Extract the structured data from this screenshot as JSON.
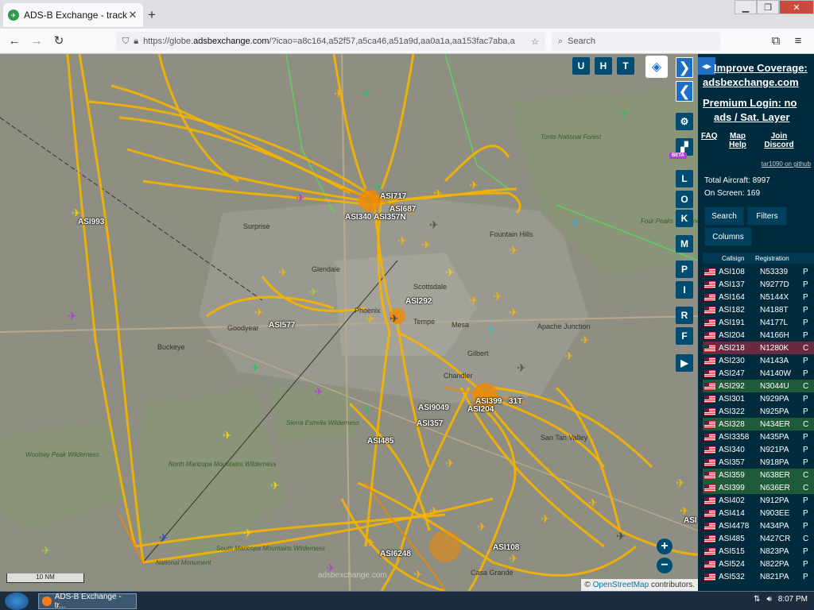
{
  "browser": {
    "tab_title": "ADS-B Exchange - track aircraft",
    "tab_close": "✕",
    "new_tab": "+",
    "url_prefix": "https://globe.",
    "url_domain": "adsbexchange.com",
    "url_rest": "/?icao=a8c164,a52f57,a5ca46,a51a9d,aa0a1a,aa153fac7aba,a",
    "search_placeholder": "Search"
  },
  "map": {
    "top_buttons": [
      "U",
      "H",
      "T"
    ],
    "right_buttons": [
      "L",
      "O",
      "K",
      "M",
      "P",
      "I",
      "R",
      "F"
    ],
    "beta_badge": "BETA",
    "zoom_in": "+",
    "zoom_out": "−",
    "scale": "10 NM",
    "watermark": "adsbexchange.com",
    "attribution_prefix": "©",
    "attribution_link": "OpenStreetMap",
    "attribution_suffix": " contributors.",
    "cities": [
      {
        "name": "Surprise"
      },
      {
        "name": "Glendale"
      },
      {
        "name": "Phoenix"
      },
      {
        "name": "Scottsdale"
      },
      {
        "name": "Tempe"
      },
      {
        "name": "Mesa"
      },
      {
        "name": "Gilbert"
      },
      {
        "name": "Chandler"
      },
      {
        "name": "Goodyear"
      },
      {
        "name": "Buckeye"
      },
      {
        "name": "Fountain Hills"
      },
      {
        "name": "San Tan Valley"
      },
      {
        "name": "Casa Grande"
      },
      {
        "name": "Apache Junction"
      }
    ],
    "parks": [
      {
        "name": "Tonto National Forest"
      },
      {
        "name": "Four Peaks Wilderness"
      },
      {
        "name": "North Maricopa Mountains Wilderness"
      },
      {
        "name": "South Maricopa Mountains Wilderness"
      },
      {
        "name": "Woolsey Peak Wilderness"
      },
      {
        "name": "National Monument"
      },
      {
        "name": "Sierra Estrella Wilderness"
      }
    ],
    "callsigns": [
      {
        "text": "ASI993"
      },
      {
        "text": "ASI717"
      },
      {
        "text": "ASI687"
      },
      {
        "text": "ASI340"
      },
      {
        "text": "ASI357N"
      },
      {
        "text": "ASI292"
      },
      {
        "text": "ASI577"
      },
      {
        "text": "ASI399"
      },
      {
        "text": "31T"
      },
      {
        "text": "ASI204"
      },
      {
        "text": "ASI9049"
      },
      {
        "text": "ASI357"
      },
      {
        "text": "ASI485"
      },
      {
        "text": "ASI6248"
      },
      {
        "text": "ASI108"
      },
      {
        "text": "ASI"
      }
    ]
  },
  "sidebar": {
    "promo1_line1": "Improve Coverage:",
    "promo1_line2": "adsbexchange.com",
    "promo2_line1": "Premium Login: no",
    "promo2_line2": "ads / Sat. Layer",
    "faq": "FAQ",
    "map_help_1": "Map",
    "map_help_2": "Help",
    "join_1": "Join",
    "join_2": "Discord",
    "github": "tar1090 on github",
    "total_label": "Total Aircraft:",
    "total_value": "8997",
    "onscreen_label": "On Screen:",
    "onscreen_value": "169",
    "search_btn": "Search",
    "filters_btn": "Filters",
    "columns_btn": "Columns",
    "col_callsign": "Callsign",
    "col_registration": "Registration",
    "rows": [
      {
        "cs": "ASI108",
        "reg": "N53339",
        "ex": "P",
        "bg": "#002b3d"
      },
      {
        "cs": "ASI137",
        "reg": "N9277D",
        "ex": "P",
        "bg": "#002b3d"
      },
      {
        "cs": "ASI164",
        "reg": "N5144X",
        "ex": "P",
        "bg": "#002b3d"
      },
      {
        "cs": "ASI182",
        "reg": "N4188T",
        "ex": "P",
        "bg": "#002b3d"
      },
      {
        "cs": "ASI191",
        "reg": "N4177L",
        "ex": "P",
        "bg": "#002b3d"
      },
      {
        "cs": "ASI204",
        "reg": "N4166H",
        "ex": "P",
        "bg": "#002b3d"
      },
      {
        "cs": "ASI218",
        "reg": "N1280K",
        "ex": "C",
        "bg": "#6b2a44"
      },
      {
        "cs": "ASI230",
        "reg": "N4143A",
        "ex": "P",
        "bg": "#002b3d"
      },
      {
        "cs": "ASI247",
        "reg": "N4140W",
        "ex": "P",
        "bg": "#002b3d"
      },
      {
        "cs": "ASI292",
        "reg": "N3044U",
        "ex": "C",
        "bg": "#1f5a3a"
      },
      {
        "cs": "ASI301",
        "reg": "N929PA",
        "ex": "P",
        "bg": "#002b3d"
      },
      {
        "cs": "ASI322",
        "reg": "N925PA",
        "ex": "P",
        "bg": "#002b3d"
      },
      {
        "cs": "ASI328",
        "reg": "N434ER",
        "ex": "C",
        "bg": "#1f5a3a"
      },
      {
        "cs": "ASI3358",
        "reg": "N435PA",
        "ex": "P",
        "bg": "#002b3d"
      },
      {
        "cs": "ASI340",
        "reg": "N921PA",
        "ex": "P",
        "bg": "#002b3d"
      },
      {
        "cs": "ASI357",
        "reg": "N918PA",
        "ex": "P",
        "bg": "#002b3d"
      },
      {
        "cs": "ASI359",
        "reg": "N638ER",
        "ex": "C",
        "bg": "#1f5a3a"
      },
      {
        "cs": "ASI399",
        "reg": "N636ER",
        "ex": "C",
        "bg": "#1f5a3a"
      },
      {
        "cs": "ASI402",
        "reg": "N912PA",
        "ex": "P",
        "bg": "#002b3d"
      },
      {
        "cs": "ASI414",
        "reg": "N903EE",
        "ex": "P",
        "bg": "#002b3d"
      },
      {
        "cs": "ASI4478",
        "reg": "N434PA",
        "ex": "P",
        "bg": "#002b3d"
      },
      {
        "cs": "ASI485",
        "reg": "N427CR",
        "ex": "C",
        "bg": "#002b3d"
      },
      {
        "cs": "ASI515",
        "reg": "N823PA",
        "ex": "P",
        "bg": "#002b3d"
      },
      {
        "cs": "ASI524",
        "reg": "N822PA",
        "ex": "P",
        "bg": "#002b3d"
      },
      {
        "cs": "ASI532",
        "reg": "N821PA",
        "ex": "P",
        "bg": "#002b3d"
      }
    ]
  },
  "taskbar": {
    "item": "ADS-B Exchange - tr...",
    "time": "8:07 PM"
  },
  "colors": {
    "track": "#f5b400",
    "track_dark": "#f08a00",
    "map_bg": "#8f8e82",
    "sidebar_bg": "#002b3d",
    "button_bg": "#004d73"
  }
}
